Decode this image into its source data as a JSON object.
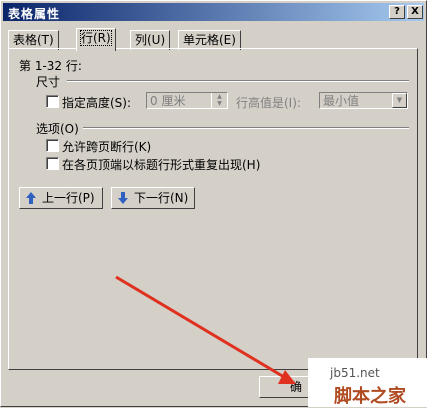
{
  "window": {
    "title": "表格属性",
    "help_glyph": "?",
    "close_glyph": "X"
  },
  "tabs": [
    {
      "label": "表格(T)",
      "active": false
    },
    {
      "label": "行(R)",
      "active": true
    },
    {
      "label": "列(U)",
      "active": false
    },
    {
      "label": "单元格(E)",
      "active": false
    }
  ],
  "row_panel": {
    "rows_label": "第 1-32 行:",
    "size_group": "尺寸",
    "specify_height_label": "指定高度(S):",
    "specify_height_checked": false,
    "height_value": "0 厘米",
    "row_height_is_label": "行高值是(I):",
    "row_height_is_value": "最小值",
    "options_group": "选项(O)",
    "allow_break_label": "允许跨页断行(K)",
    "allow_break_checked": false,
    "repeat_header_label": "在各页顶端以标题行形式重复出现(H)",
    "repeat_header_checked": false,
    "prev_row_button": "上一行(P)",
    "next_row_button": "下一行(N)"
  },
  "footer": {
    "ok_button_partial": "确"
  },
  "watermark": {
    "site": "jb51.net",
    "brand": "脚本之家"
  },
  "colors": {
    "dialog_bg": "#d4d0c8",
    "title_start": "#0a246a",
    "title_end": "#a6caf0",
    "annotation_arrow": "#e03020",
    "arrow_icon": "#3060c0"
  }
}
